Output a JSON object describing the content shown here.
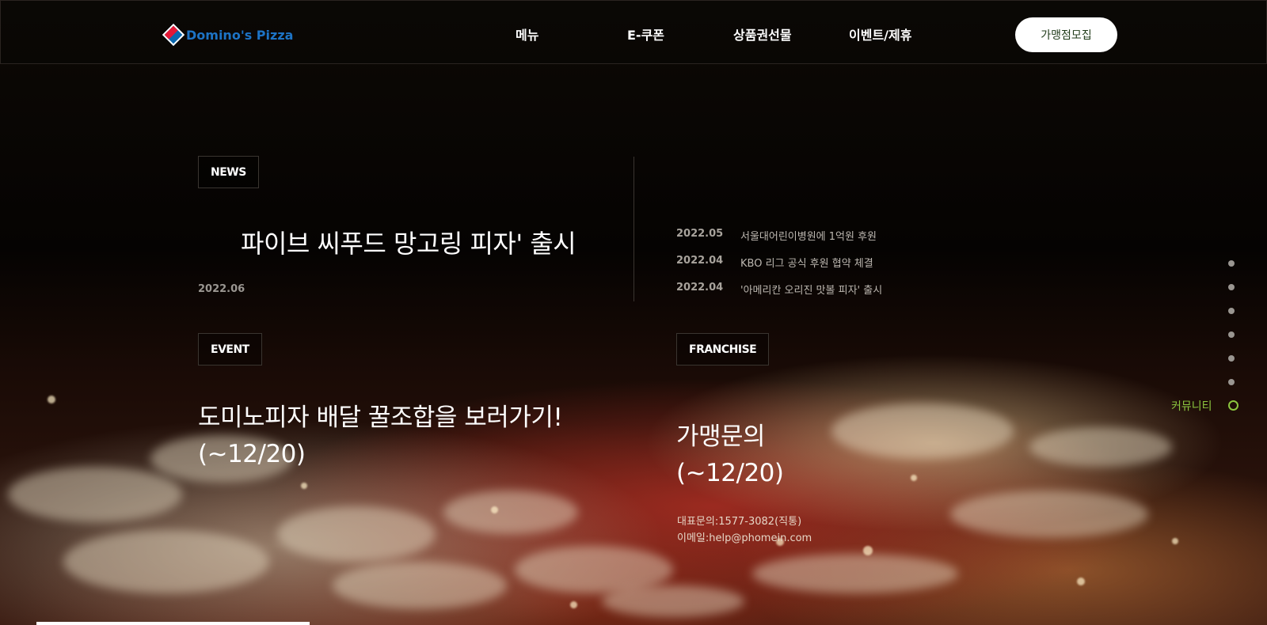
{
  "header": {
    "logo_text": "Domino's Pizza",
    "nav": [
      "메뉴",
      "E-쿠폰",
      "상품권선물",
      "이벤트/제휴"
    ],
    "cta": "가맹점모집"
  },
  "news": {
    "tag": "NEWS",
    "headline": "파이브 씨푸드 망고링 피자' 출시",
    "date": "2022.06",
    "list": [
      {
        "date": "2022.05",
        "title": "서울대어린이병원에 1억원 후원"
      },
      {
        "date": "2022.04",
        "title": "KBO 리그 공식 후원 협약 체결"
      },
      {
        "date": "2022.04",
        "title": "'아메리칸 오리진 맛볼 피자' 출시"
      }
    ]
  },
  "event": {
    "tag": "EVENT",
    "line1": "도미노피자 배달 꿀조합을 보러가기!",
    "line2": "(~12/20)"
  },
  "franchise": {
    "tag": "FRANCHISE",
    "line1": "가맹문의",
    "line2": "(~12/20)",
    "phone": "대표문의:1577-3082(직통)",
    "email": "이메일:help@phomein.com"
  },
  "side_nav": {
    "active_label": "커뮤니티",
    "active_color": "#8cc63f"
  }
}
